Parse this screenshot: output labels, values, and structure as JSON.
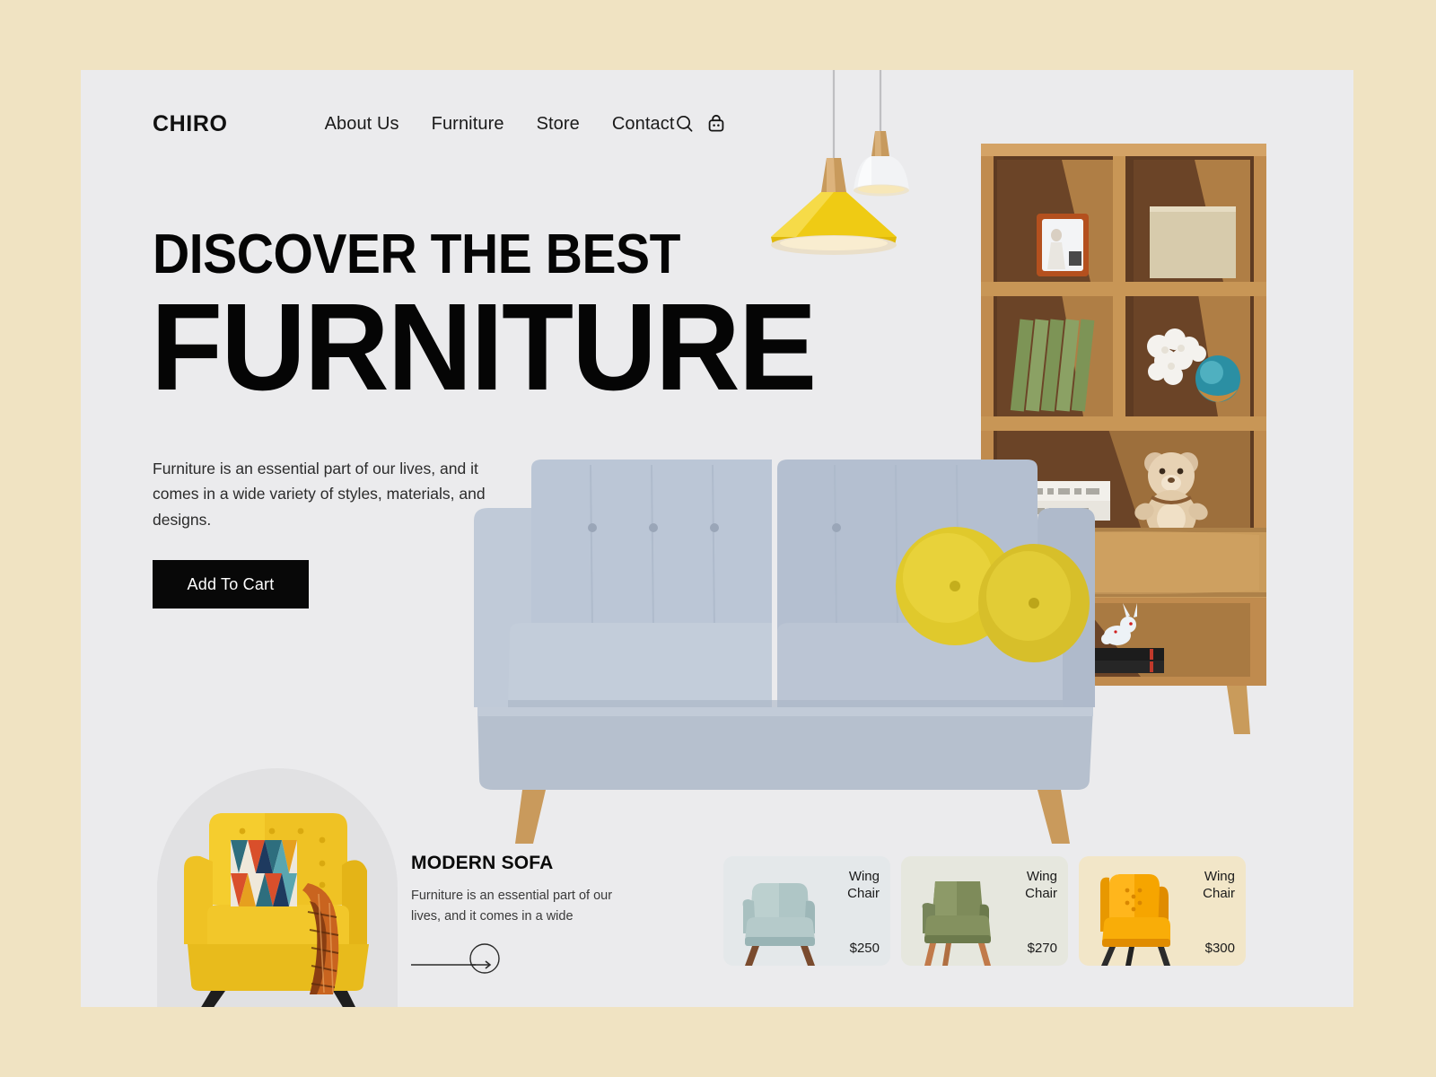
{
  "theme": {
    "page_bg": "#F0E3C2",
    "card_bg": "#EBEBED",
    "accent_dark": "#080808",
    "accent_yellow": "#F2C318",
    "sofa_blue": "#B8C4D4"
  },
  "nav": {
    "logo": "CHIRO",
    "links": [
      {
        "label": "About Us"
      },
      {
        "label": "Furniture"
      },
      {
        "label": "Store"
      },
      {
        "label": "Contact"
      }
    ],
    "icons": [
      {
        "name": "search-icon"
      },
      {
        "name": "shopping-bag-icon"
      }
    ]
  },
  "hero": {
    "title_line1": "DISCOVER THE BEST",
    "title_line2": "FURNITURE",
    "description": "Furniture is an essential part of our lives, and it comes in a wide variety of styles, materials, and designs.",
    "cta_label": "Add To Cart"
  },
  "feature": {
    "title": "MODERN SOFA",
    "description": "Furniture is an essential part of our lives, and it comes in a wide",
    "arrow_name": "arrow-right-circle-icon"
  },
  "products": [
    {
      "name_line1": "Wing",
      "name_line2": "Chair",
      "price": "$250",
      "bg": "#E4E8EA",
      "chair_color": "#AFC6C6",
      "chair_shade": "#99B4B5",
      "leg_color": "#7A4B2E"
    },
    {
      "name_line1": "Wing",
      "name_line2": "Chair",
      "price": "$270",
      "bg": "#E6E7DE",
      "chair_color": "#7E8B5A",
      "chair_shade": "#6C7A4C",
      "leg_color": "#C17A4A"
    },
    {
      "name_line1": "Wing",
      "name_line2": "Chair",
      "price": "$300",
      "bg": "#F2E6C8",
      "chair_color": "#F6A500",
      "chair_shade": "#E08C00",
      "leg_color": "#2B2B2B"
    }
  ],
  "imagery": {
    "pendant_lamp_yellow": "pendant-lamp-yellow",
    "pendant_lamp_white": "pendant-lamp-white",
    "bookshelf": "wooden-bookshelf",
    "sofa": "light-blue-tufted-sofa",
    "armchair": "yellow-armchair-with-geometric-pillow"
  }
}
